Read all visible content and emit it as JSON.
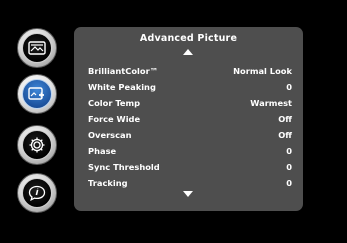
{
  "panel": {
    "title": "Advanced Picture"
  },
  "menu_items": [
    {
      "label": "BrilliantColor™",
      "value": "Normal Look"
    },
    {
      "label": "White Peaking",
      "value": "0"
    },
    {
      "label": "Color Temp",
      "value": "Warmest"
    },
    {
      "label": "Force Wide",
      "value": "Off"
    },
    {
      "label": "Overscan",
      "value": "Off"
    },
    {
      "label": "Phase",
      "value": "0"
    },
    {
      "label": "Sync Threshold",
      "value": "0"
    },
    {
      "label": "Tracking",
      "value": "0"
    }
  ],
  "nav_icons": [
    {
      "name": "basic-picture-icon",
      "active": false
    },
    {
      "name": "advanced-picture-icon",
      "active": true
    },
    {
      "name": "settings-gear-icon",
      "active": false
    },
    {
      "name": "help-info-icon",
      "active": false
    }
  ],
  "colors": {
    "panel_bg": "#4e4e4e",
    "active_icon": "#2d6ec0",
    "text": "#ffffff"
  }
}
